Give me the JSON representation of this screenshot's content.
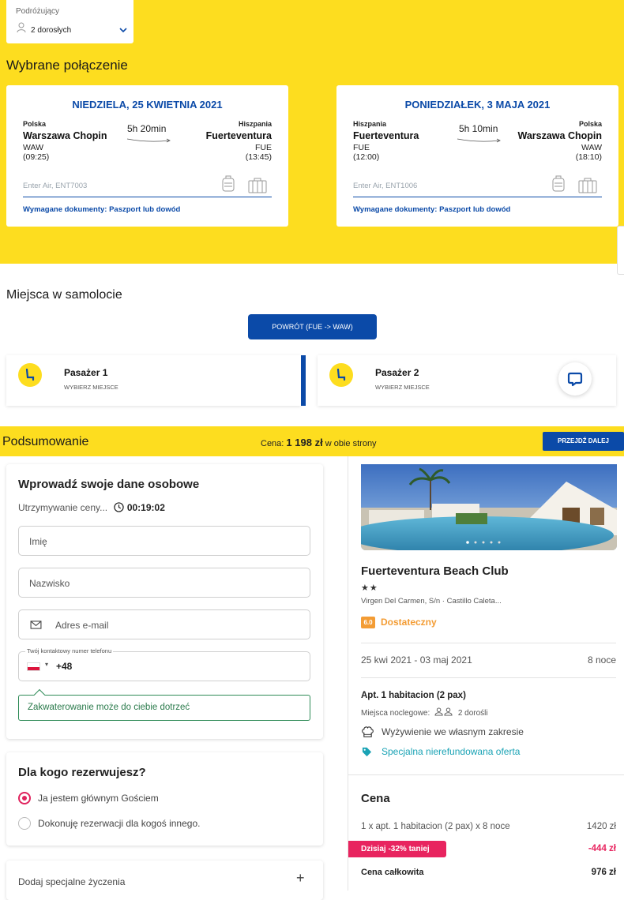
{
  "travelers": {
    "label": "Podróżujący",
    "value": "2 dorosłych"
  },
  "selected_title": "Wybrane połączenie",
  "flights": [
    {
      "date": "NIEDZIELA, 25 KWIETNIA 2021",
      "from_country": "Polska",
      "from_name": "Warszawa Chopin",
      "from_code": "WAW",
      "from_time": "(09:25)",
      "duration": "5h 20min",
      "to_country": "Hiszpania",
      "to_name": "Fuerteventura",
      "to_code": "FUE",
      "to_time": "(13:45)",
      "airline": "Enter Air, ENT7003",
      "docs": "Wymagane dokumenty: Paszport lub dowód"
    },
    {
      "date": "PONIEDZIAŁEK, 3 MAJA 2021",
      "from_country": "Hiszpania",
      "from_name": "Fuerteventura",
      "from_code": "FUE",
      "from_time": "(12:00)",
      "duration": "5h 10min",
      "to_country": "Polska",
      "to_name": "Warszawa Chopin",
      "to_code": "WAW",
      "to_time": "(18:10)",
      "airline": "Enter Air, ENT1006",
      "docs": "Wymagane dokumenty: Paszport lub dowód"
    }
  ],
  "seats": {
    "title": "Miejsca w samolocie",
    "return_button": "POWRÓT (FUE -> WAW)",
    "passengers": [
      {
        "name": "Pasażer 1",
        "action": "WYBIERZ MIEJSCE"
      },
      {
        "name": "Pasażer 2",
        "action": "WYBIERZ MIEJSCE"
      }
    ]
  },
  "summary": {
    "title": "Podsumowanie",
    "price_label": "Cena:",
    "price_value": "1 198 zł",
    "price_suffix": "w obie strony",
    "next_button": "PRZEJDŹ DALEJ"
  },
  "form": {
    "title": "Wprowadź swoje dane osobowe",
    "hold_label": "Utrzymywanie ceny...",
    "hold_time": "00:19:02",
    "first_name_placeholder": "Imię",
    "last_name_placeholder": "Nazwisko",
    "email_placeholder": "Adres e-mail",
    "phone_label": "Twój kontaktowy numer telefonu",
    "phone_prefix": "+48",
    "notice": "Zakwaterowanie może do ciebie dotrzeć"
  },
  "booking_for": {
    "title": "Dla kogo rezerwujesz?",
    "options": [
      "Ja jestem głównym Gościem",
      "Dokonuję rezerwacji dla kogoś innego."
    ],
    "selected": 0
  },
  "special": {
    "label": "Dodaj specjalne życzenia",
    "icon": "plus-icon"
  },
  "hotel": {
    "name": "Fuerteventura Beach Club",
    "stars": "★★",
    "address": "Virgen Del Carmen, S/n · Castillo Caleta...",
    "score": "6.0",
    "score_label": "Dostateczny",
    "dates": "25 kwi 2021 - 03 maj 2021",
    "nights": "8 noce",
    "room": "Apt. 1 habitacion (2 pax)",
    "beds_label": "Miejsca noclegowe:",
    "beds_value": "2 dorośli",
    "meal": "Wyżywienie we własnym zakresie",
    "offer": "Specjalna nierefundowana oferta",
    "offer_color": "#1aa3b5"
  },
  "price": {
    "title": "Cena",
    "line_label": "1 x apt. 1 habitacion (2 pax) x 8 noce",
    "line_value": "1420 zł",
    "discount_label": "Dzisiaj -32% taniej",
    "discount_value": "-444 zł",
    "total_label": "Cena całkowita",
    "total_value": "976 zł"
  },
  "colors": {
    "brand_yellow": "#fddd1f",
    "brand_blue": "#0b4aa8",
    "discount_pink": "#e8245f",
    "score_orange": "#f39c34"
  }
}
